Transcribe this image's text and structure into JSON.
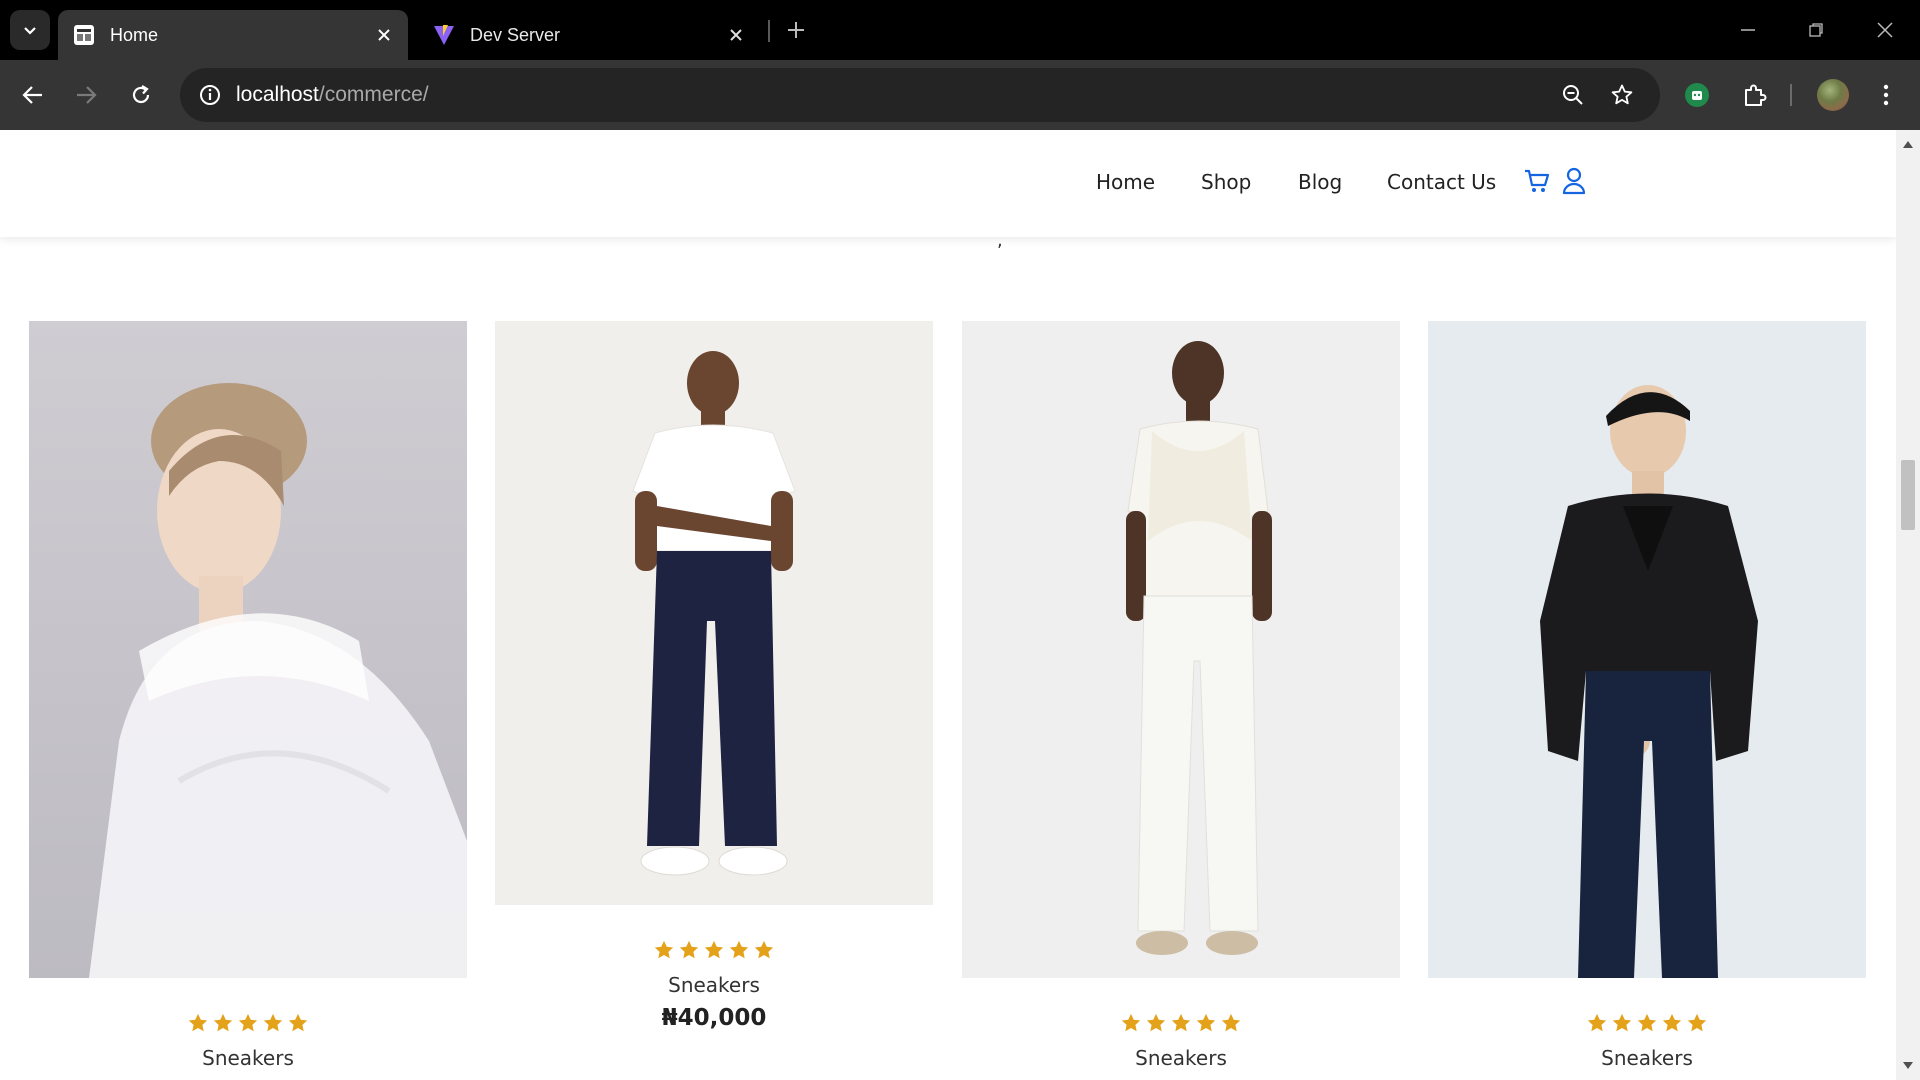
{
  "browser": {
    "tabs": [
      {
        "title": "Home",
        "active": true,
        "favicon": "store-favicon"
      },
      {
        "title": "Dev Server",
        "active": false,
        "favicon": "vite-favicon"
      }
    ],
    "url": {
      "host": "localhost",
      "path": "/commerce/"
    },
    "accent": "#1f8a4c"
  },
  "site": {
    "nav": {
      "links": [
        "Home",
        "Shop",
        "Blog",
        "Contact Us"
      ],
      "icons": [
        "cart-icon",
        "user-icon"
      ],
      "icon_color": "#1565e0"
    },
    "stray_mark": ",",
    "products": [
      {
        "name": "Sneakers",
        "rating": 5,
        "price": "",
        "image": "woman-white-organza-portrait",
        "bg": "#c9c7cc"
      },
      {
        "name": "Sneakers",
        "rating": 5,
        "price": "₦40,000",
        "image": "man-white-tee-dark-jeans",
        "bg": "#f1efec"
      },
      {
        "name": "Sneakers",
        "rating": 5,
        "price": "",
        "image": "man-white-linen-outfit",
        "bg": "#efefef"
      },
      {
        "name": "Sneakers",
        "rating": 5,
        "price": "",
        "image": "man-black-blazer-jeans",
        "bg": "#e6ebf0"
      }
    ],
    "star_color": "#e3a21a"
  }
}
